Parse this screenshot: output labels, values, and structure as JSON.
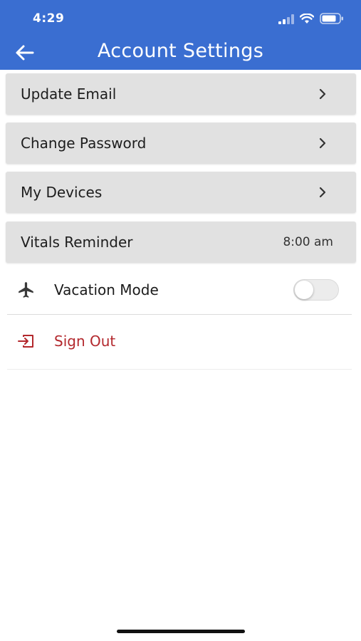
{
  "status_bar": {
    "time": "4:29",
    "icons": [
      "cellular-signal-icon",
      "wifi-icon",
      "battery-icon"
    ]
  },
  "header": {
    "title": "Account Settings",
    "back_icon": "arrow-left-icon",
    "background_color": "#3a6ed1"
  },
  "menu": {
    "update_email": "Update Email",
    "change_password": "Change Password",
    "my_devices": "My Devices",
    "vitals_reminder": "Vitals Reminder",
    "vitals_reminder_time": "8:00 am"
  },
  "vacation_mode": {
    "label": "Vacation Mode",
    "icon": "airplane-icon",
    "enabled": false
  },
  "sign_out": {
    "label": "Sign Out",
    "icon": "sign-out-icon",
    "color": "#b3282d"
  }
}
